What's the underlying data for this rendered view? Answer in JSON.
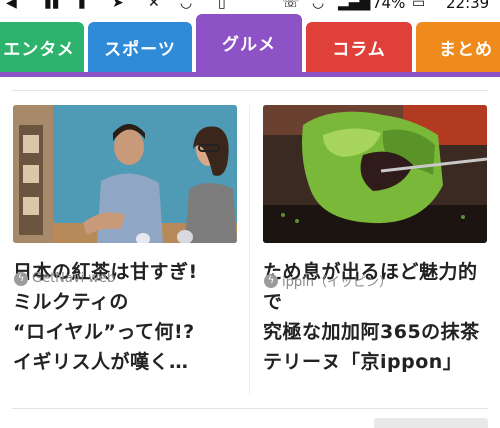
{
  "status_bar": {
    "battery_percent": "74%",
    "time": "22:39"
  },
  "tabs": [
    {
      "label": "エンタメ",
      "color": "#2db36b",
      "active": false
    },
    {
      "label": "スポーツ",
      "color": "#2f8ad8",
      "active": false
    },
    {
      "label": "グルメ",
      "color": "#8e52c7",
      "active": true
    },
    {
      "label": "コラム",
      "color": "#e0403a",
      "active": false
    },
    {
      "label": "まとめ",
      "color": "#f08a1c",
      "active": false
    }
  ],
  "active_tab_color": "#8e52c7",
  "articles": [
    {
      "headline": "日本の紅茶は甘すぎ!\nミルクティの\n“ロイヤル”って何!?\nイギリス人が嘆く…",
      "source": "GetNavi web",
      "thumbnail": "two-people-talking-photo"
    },
    {
      "headline": "ため息が出るほど魅力的で\n究極な加加阿365の抹茶\nテリーヌ「京ippon」",
      "source": "ippin（イッピン）",
      "thumbnail": "matcha-terrine-photo"
    }
  ]
}
